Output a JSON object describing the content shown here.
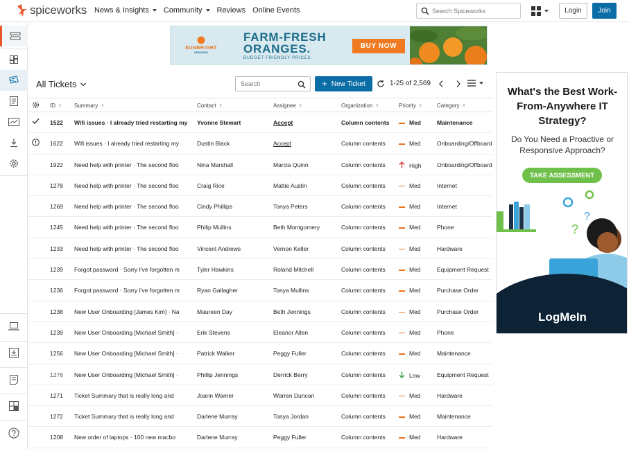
{
  "brand": {
    "name": "spiceworks",
    "accent": "#e8572b",
    "primary": "#0b6da6"
  },
  "nav": {
    "links": [
      {
        "label": "News & Insights",
        "dropdown": true
      },
      {
        "label": "Community",
        "dropdown": true
      },
      {
        "label": "Reviews",
        "dropdown": false
      },
      {
        "label": "Online Events",
        "dropdown": false
      }
    ],
    "search_placeholder": "Search Spiceworks",
    "login_label": "Login",
    "join_label": "Join"
  },
  "banner": {
    "brand": "SUNBRIGHT",
    "brand_sub": "ORANGES",
    "title_line1": "FARM-FRESH",
    "title_line2": "ORANGES.",
    "subtitle": "BUDGET FRIENDLY PRICES.",
    "button": "BUY NOW"
  },
  "toolbar": {
    "title": "All Tickets",
    "search_placeholder": "Search",
    "new_ticket_label": "New Ticket",
    "pager_text": "1-25 of 2,569"
  },
  "columns": {
    "id": "ID",
    "summary": "Summary",
    "contact": "Contact",
    "assignee": "Assignee",
    "organization": "Organization",
    "priority": "Priority",
    "category": "Category"
  },
  "tickets": [
    {
      "status": "check-icon",
      "id": "1522",
      "summary": "Wifi issues · I already tried restarting my",
      "contact": "Yvonne Stewart",
      "assignee": "Accept",
      "org": "Column contents",
      "priority": "Med",
      "category": "Maintenance",
      "bold": true
    },
    {
      "status": "alert-icon",
      "id": "1622",
      "summary": "Wifi issues · I already tried restarting my",
      "contact": "Dustin Black",
      "assignee": "Accept",
      "org": "Column contents",
      "priority": "Med",
      "category": "Onboarding/Offboarding",
      "bold": false
    },
    {
      "status": "",
      "id": "1922",
      "summary": "Need help with printer · The second floo",
      "contact": "Nina Marshall",
      "assignee": "Marcia Quinn",
      "org": "Column contents",
      "priority": "High",
      "category": "Onboarding/Offboarding",
      "bold": false
    },
    {
      "status": "",
      "id": "1278",
      "summary": "Need help with printer · The second floo",
      "contact": "Craig Rice",
      "assignee": "Mattie Austin",
      "org": "Column contents",
      "priority": "Med",
      "category": "Internet",
      "bold": false
    },
    {
      "status": "",
      "id": "1269",
      "summary": "Need help with printer · The second floo",
      "contact": "Cindy Phillips",
      "assignee": "Tonya Peters",
      "org": "Column contents",
      "priority": "Med",
      "category": "Internet",
      "bold": false
    },
    {
      "status": "",
      "id": "1245",
      "summary": "Need help with printer · The second floo",
      "contact": "Philip Mullins",
      "assignee": "Beth Montgomery",
      "org": "Column contents",
      "priority": "Med",
      "category": "Phone",
      "bold": false
    },
    {
      "status": "",
      "id": "1233",
      "summary": "Need help with printer · The second floo",
      "contact": "Vincent Andrews",
      "assignee": "Vernon Keller",
      "org": "Column contents",
      "priority": "Med",
      "category": "Hardware",
      "bold": false
    },
    {
      "status": "",
      "id": "1239",
      "summary": "Forgot password · Sorry I've forgotten m",
      "contact": "Tyler Hawkins",
      "assignee": "Roland Mitchell",
      "org": "Column contents",
      "priority": "Med",
      "category": "Equipment Request",
      "bold": false
    },
    {
      "status": "",
      "id": "1236",
      "summary": "Forgot password · Sorry I've forgotten m",
      "contact": "Ryan Gallagher",
      "assignee": "Tonya Mullins",
      "org": "Column contents",
      "priority": "Med",
      "category": "Purchase Order",
      "bold": false
    },
    {
      "status": "",
      "id": "1238",
      "summary": "New User Onboarding [James Kim] · Na",
      "contact": "Maureen Day",
      "assignee": "Beth Jennings",
      "org": "Column contents",
      "priority": "Med",
      "category": "Purchase Order",
      "bold": false
    },
    {
      "status": "",
      "id": "1239",
      "summary": "New User Onboarding [Michael Smith] ·",
      "contact": "Erik Stevens",
      "assignee": "Eleanor Allen",
      "org": "Column contents",
      "priority": "Med",
      "category": "Phone",
      "bold": false
    },
    {
      "status": "",
      "id": "1256",
      "summary": "New User Onboarding [Michael Smith] ·",
      "contact": "Patrick Walker",
      "assignee": "Peggy Fuller",
      "org": "Column contents",
      "priority": "Med",
      "category": "Maintenance",
      "bold": false
    },
    {
      "status": "",
      "id": "1276",
      "summary": "New User Onboarding [Michael Smith] ·",
      "contact": "Phillip Jennings",
      "assignee": "Derrick Berry",
      "org": "Column contents",
      "priority": "Low",
      "category": "Equipment Request",
      "bold": false
    },
    {
      "status": "",
      "id": "1271",
      "summary": "Ticket Summary that is really long and",
      "contact": "Joann Warner",
      "assignee": "Warren Duncan",
      "org": "Column contents",
      "priority": "Med",
      "category": "Hardware",
      "bold": false
    },
    {
      "status": "",
      "id": "1272",
      "summary": "Ticket Summary that is really long and",
      "contact": "Darlene Murray",
      "assignee": "Tonya Jordan",
      "org": "Column contents",
      "priority": "Med",
      "category": "Maintenance",
      "bold": false
    },
    {
      "status": "",
      "id": "1208",
      "summary": "New order of laptops · 100 new macbo",
      "contact": "Darlene Murray",
      "assignee": "Peggy Fuller",
      "org": "Column contents",
      "priority": "Med",
      "category": "Hardware",
      "bold": false
    }
  ],
  "priority_colors": {
    "Med": "#e8731c",
    "High": "#d9342b",
    "Low": "#2e9e4a"
  },
  "ad": {
    "headline": "What's the Best Work-From-Anywhere IT Strategy?",
    "subline": "Do You Need a Proactive or Responsive Approach?",
    "button": "TAKE ASSESSMENT",
    "logo": "LogMeIn"
  }
}
